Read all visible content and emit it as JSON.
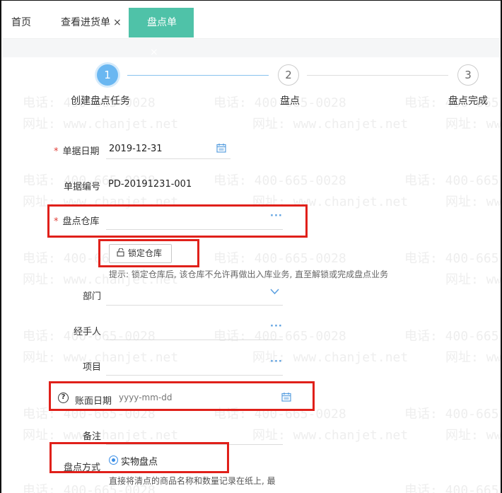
{
  "tabs": [
    {
      "label": "首页",
      "closable": false
    },
    {
      "label": "查看进货单",
      "closable": true
    },
    {
      "label": "盘点单",
      "closable": true,
      "active": true
    }
  ],
  "close_glyph": "×",
  "watermark": {
    "phone": "电话: 400-665-0028",
    "site": "网址: www.chanjet.net"
  },
  "steps": [
    {
      "number": "1",
      "label": "创建盘点任务",
      "state": "active"
    },
    {
      "number": "2",
      "label": "盘点",
      "state": "idle"
    },
    {
      "number": "3",
      "label": "盘点完成",
      "state": "idle"
    }
  ],
  "form": {
    "doc_date": {
      "label": "单据日期",
      "value": "2019-12-31",
      "required": true,
      "icon": "calendar-icon"
    },
    "doc_no": {
      "label": "单据编号",
      "value": "PD-20191231-001"
    },
    "warehouse": {
      "label": "盘点仓库",
      "required": true,
      "icon": "more-icon",
      "value": ""
    },
    "lock_button": {
      "label": "锁定仓库",
      "icon": "lock-icon"
    },
    "hint": "提示: 锁定仓库后, 该仓库不允许再做出入库业务, 直至解锁或完成盘点业务",
    "department": {
      "label": "部门",
      "icon": "chevron-down-icon"
    },
    "handler": {
      "label": "经手人",
      "icon": "more-icon"
    },
    "project": {
      "label": "项目",
      "icon": "more-icon"
    },
    "book_date": {
      "label": "账面日期",
      "placeholder": "yyyy-mm-dd",
      "icon": "calendar-icon",
      "help_icon": "question-icon"
    },
    "remark": {
      "label": "备注"
    },
    "method": {
      "label": "盘点方式",
      "option": "实物盘点",
      "selected": true
    },
    "method_desc": "直接将清点的商品名称和数量记录在纸上, 最"
  },
  "colors": {
    "accent": "#4fc2a8",
    "step_active": "#6ab7f1",
    "highlight": "#e0201a",
    "required": "#e0403a",
    "icon": "#5a9fe0"
  }
}
